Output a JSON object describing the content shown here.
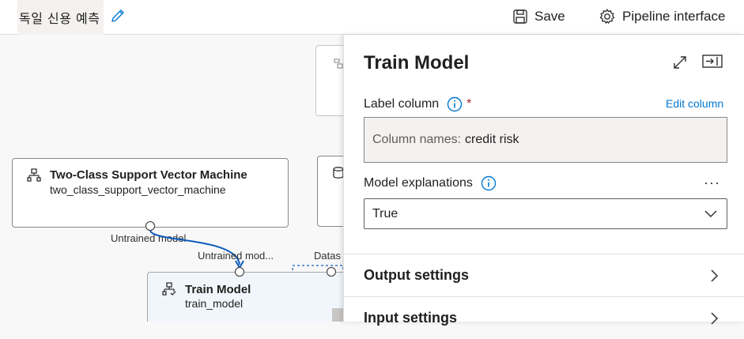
{
  "header": {
    "pipeline_title": "독일 신용 예측",
    "save_label": "Save",
    "pipeline_interface_label": "Pipeline interface"
  },
  "canvas": {
    "svm_node": {
      "title": "Two-Class Support Vector Machine",
      "name": "two_class_support_vector_machine",
      "output_port": "Untrained model"
    },
    "train_node": {
      "title": "Train Model",
      "name": "train_model",
      "input_port_1": "Untrained mod...",
      "input_port_2": "Datas"
    }
  },
  "panel": {
    "title": "Train Model",
    "label_column": {
      "label": "Label column",
      "required_mark": "*",
      "edit_link": "Edit column",
      "value_prefix": "Column names:",
      "value": "credit risk"
    },
    "model_explanations": {
      "label": "Model explanations",
      "selected": "True"
    },
    "sections": [
      "Output settings",
      "Input settings"
    ]
  },
  "colors": {
    "accent": "#0078d4",
    "connector": "#0f5dbb",
    "required": "#a4262c"
  }
}
